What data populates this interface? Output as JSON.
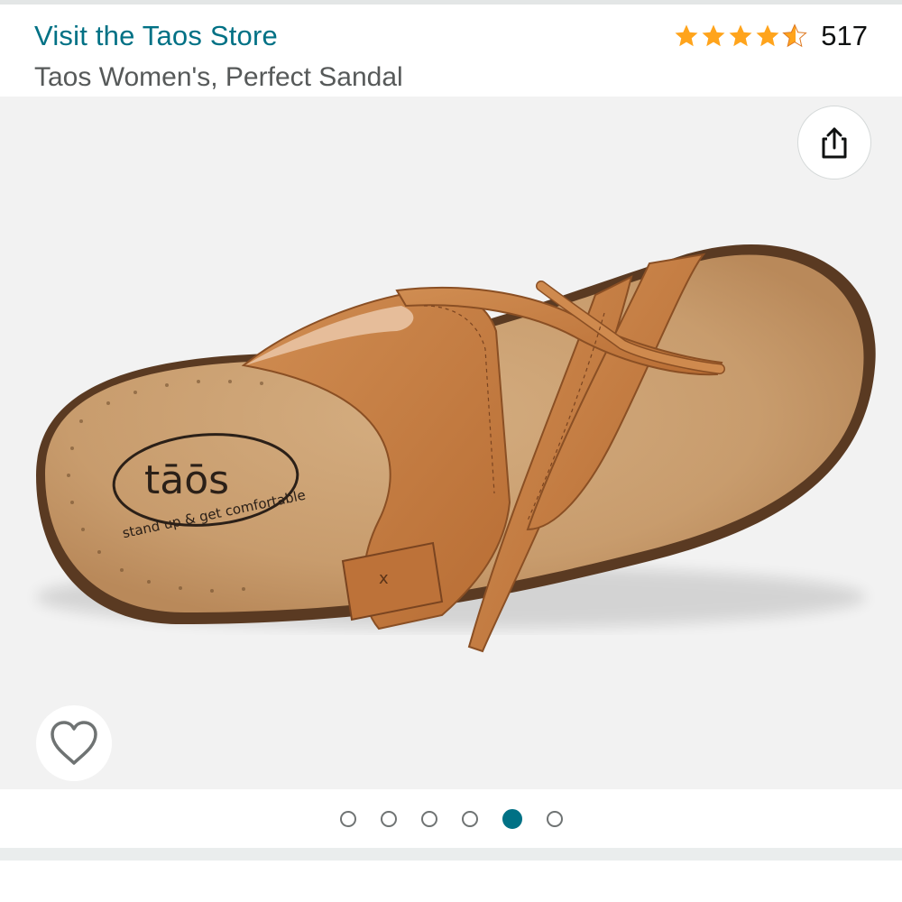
{
  "header": {
    "store_link": "Visit the Taos Store",
    "product_title": "Taos Women's, Perfect Sandal",
    "rating": {
      "value": 4.5,
      "max": 5,
      "count": "517"
    }
  },
  "gallery": {
    "image_alt": "Tan leather strappy toe-loop sandal with suede footbed, top view",
    "brand_logo": "tāōs",
    "brand_tagline": "stand up & get comfortable",
    "total_images": 6,
    "active_index": 5
  },
  "icons": {
    "share": "share-icon",
    "wishlist": "heart-outline-icon",
    "star": "star-icon"
  },
  "colors": {
    "link": "#007185",
    "star": "#ffa41c",
    "active_dot": "#007185",
    "sandal_leather": "#c77f45",
    "footbed": "#c9a074"
  }
}
